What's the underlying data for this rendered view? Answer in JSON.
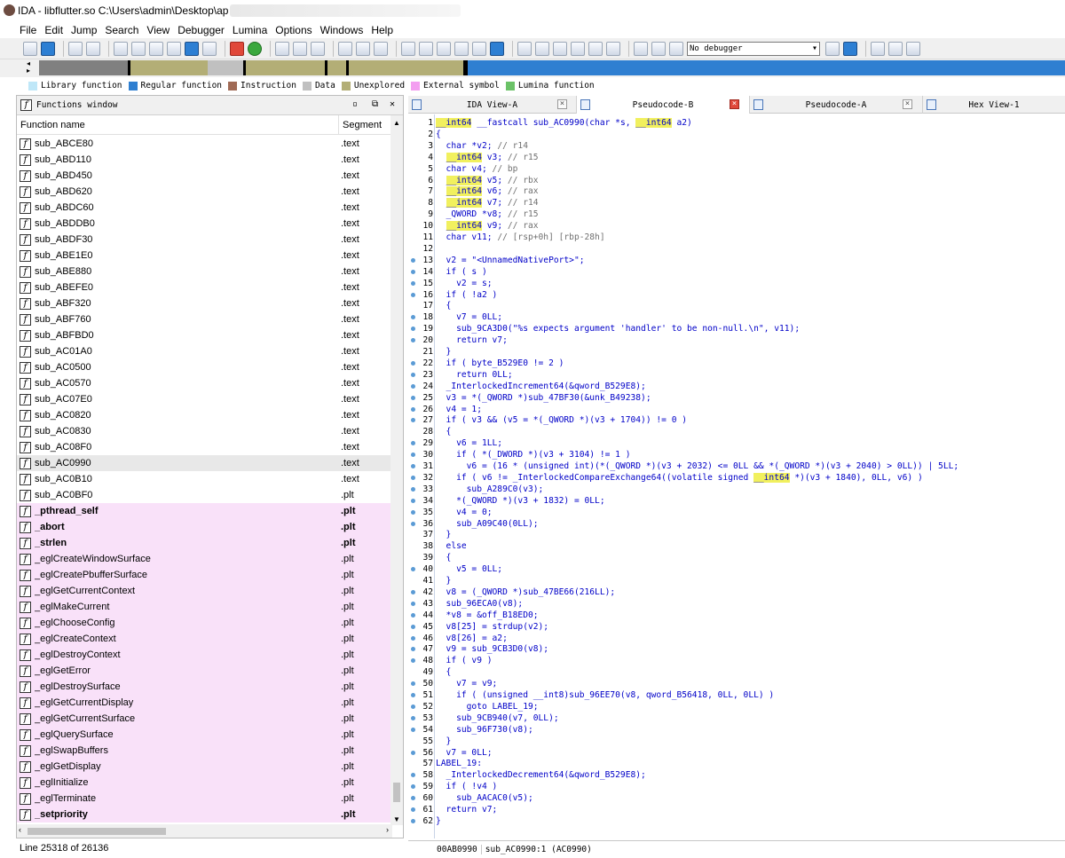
{
  "window": {
    "title": "IDA - libflutter.so C:\\Users\\admin\\Desktop\\ap"
  },
  "menu": [
    "File",
    "Edit",
    "Jump",
    "Search",
    "View",
    "Debugger",
    "Lumina",
    "Options",
    "Windows",
    "Help"
  ],
  "toolbar": {
    "debugger_select": "No debugger"
  },
  "legend": [
    {
      "label": "Library function",
      "color": "#bfe7f8"
    },
    {
      "label": "Regular function",
      "color": "#2f7fd1"
    },
    {
      "label": "Instruction",
      "color": "#a06a55"
    },
    {
      "label": "Data",
      "color": "#c0c0c0"
    },
    {
      "label": "Unexplored",
      "color": "#b3ae76"
    },
    {
      "label": "External symbol",
      "color": "#f39ef0"
    },
    {
      "label": "Lumina function",
      "color": "#6bc267"
    }
  ],
  "functions_window": {
    "title": "Functions window",
    "col_name": "Function name",
    "col_segment": "Segment",
    "rows": [
      {
        "name": "sub_ABCE80",
        "seg": ".text",
        "style": ""
      },
      {
        "name": "sub_ABD110",
        "seg": ".text",
        "style": ""
      },
      {
        "name": "sub_ABD450",
        "seg": ".text",
        "style": ""
      },
      {
        "name": "sub_ABD620",
        "seg": ".text",
        "style": ""
      },
      {
        "name": "sub_ABDC60",
        "seg": ".text",
        "style": ""
      },
      {
        "name": "sub_ABDDB0",
        "seg": ".text",
        "style": ""
      },
      {
        "name": "sub_ABDF30",
        "seg": ".text",
        "style": ""
      },
      {
        "name": "sub_ABE1E0",
        "seg": ".text",
        "style": ""
      },
      {
        "name": "sub_ABE880",
        "seg": ".text",
        "style": ""
      },
      {
        "name": "sub_ABEFE0",
        "seg": ".text",
        "style": ""
      },
      {
        "name": "sub_ABF320",
        "seg": ".text",
        "style": ""
      },
      {
        "name": "sub_ABF760",
        "seg": ".text",
        "style": ""
      },
      {
        "name": "sub_ABFBD0",
        "seg": ".text",
        "style": ""
      },
      {
        "name": "sub_AC01A0",
        "seg": ".text",
        "style": ""
      },
      {
        "name": "sub_AC0500",
        "seg": ".text",
        "style": ""
      },
      {
        "name": "sub_AC0570",
        "seg": ".text",
        "style": ""
      },
      {
        "name": "sub_AC07E0",
        "seg": ".text",
        "style": ""
      },
      {
        "name": "sub_AC0820",
        "seg": ".text",
        "style": ""
      },
      {
        "name": "sub_AC0830",
        "seg": ".text",
        "style": ""
      },
      {
        "name": "sub_AC08F0",
        "seg": ".text",
        "style": ""
      },
      {
        "name": "sub_AC0990",
        "seg": ".text",
        "style": "sel"
      },
      {
        "name": "sub_AC0B10",
        "seg": ".text",
        "style": ""
      },
      {
        "name": "sub_AC0BF0",
        "seg": ".plt",
        "style": ""
      },
      {
        "name": "_pthread_self",
        "seg": ".plt",
        "style": "ext bold"
      },
      {
        "name": "_abort",
        "seg": ".plt",
        "style": "ext bold"
      },
      {
        "name": "_strlen",
        "seg": ".plt",
        "style": "ext bold"
      },
      {
        "name": "_eglCreateWindowSurface",
        "seg": ".plt",
        "style": "ext"
      },
      {
        "name": "_eglCreatePbufferSurface",
        "seg": ".plt",
        "style": "ext"
      },
      {
        "name": "_eglGetCurrentContext",
        "seg": ".plt",
        "style": "ext"
      },
      {
        "name": "_eglMakeCurrent",
        "seg": ".plt",
        "style": "ext"
      },
      {
        "name": "_eglChooseConfig",
        "seg": ".plt",
        "style": "ext"
      },
      {
        "name": "_eglCreateContext",
        "seg": ".plt",
        "style": "ext"
      },
      {
        "name": "_eglDestroyContext",
        "seg": ".plt",
        "style": "ext"
      },
      {
        "name": "_eglGetError",
        "seg": ".plt",
        "style": "ext"
      },
      {
        "name": "_eglDestroySurface",
        "seg": ".plt",
        "style": "ext"
      },
      {
        "name": "_eglGetCurrentDisplay",
        "seg": ".plt",
        "style": "ext"
      },
      {
        "name": "_eglGetCurrentSurface",
        "seg": ".plt",
        "style": "ext"
      },
      {
        "name": "_eglQuerySurface",
        "seg": ".plt",
        "style": "ext"
      },
      {
        "name": "_eglSwapBuffers",
        "seg": ".plt",
        "style": "ext"
      },
      {
        "name": "_eglGetDisplay",
        "seg": ".plt",
        "style": "ext"
      },
      {
        "name": "_eglInitialize",
        "seg": ".plt",
        "style": "ext"
      },
      {
        "name": "_eglTerminate",
        "seg": ".plt",
        "style": "ext"
      },
      {
        "name": "_setpriority",
        "seg": ".plt",
        "style": "ext bold"
      }
    ],
    "status": "Line 25318 of 26136"
  },
  "tabs": [
    {
      "label": "IDA View-A",
      "active": false
    },
    {
      "label": "Pseudocode-B",
      "active": true
    },
    {
      "label": "Pseudocode-A",
      "active": false
    },
    {
      "label": "Hex View-1",
      "active": false
    }
  ],
  "code": {
    "lines": [
      {
        "n": "1",
        "dot": false,
        "html": "<span class='hl'>__int64</span> __fastcall sub_AC0990(char *s, <span class='hl'>__int64</span> a2)"
      },
      {
        "n": "2",
        "dot": false,
        "html": "{"
      },
      {
        "n": "3",
        "dot": false,
        "html": "  char *v2; <span class='gr'>// r14</span>"
      },
      {
        "n": "4",
        "dot": false,
        "html": "  <span class='hl'>__int64</span> v3; <span class='gr'>// r15</span>"
      },
      {
        "n": "5",
        "dot": false,
        "html": "  char v4; <span class='gr'>// bp</span>"
      },
      {
        "n": "6",
        "dot": false,
        "html": "  <span class='hl'>__int64</span> v5; <span class='gr'>// rbx</span>"
      },
      {
        "n": "7",
        "dot": false,
        "html": "  <span class='hl'>__int64</span> v6; <span class='gr'>// rax</span>"
      },
      {
        "n": "8",
        "dot": false,
        "html": "  <span class='hl'>__int64</span> v7; <span class='gr'>// r14</span>"
      },
      {
        "n": "9",
        "dot": false,
        "html": "  _QWORD *v8; <span class='gr'>// r15</span>"
      },
      {
        "n": "10",
        "dot": false,
        "html": "  <span class='hl'>__int64</span> v9; <span class='gr'>// rax</span>"
      },
      {
        "n": "11",
        "dot": false,
        "html": "  char v11; <span class='gr'>// [rsp+0h] [rbp-28h]</span>"
      },
      {
        "n": "12",
        "dot": false,
        "html": ""
      },
      {
        "n": "13",
        "dot": true,
        "html": "  v2 = \"&lt;UnnamedNativePort&gt;\";"
      },
      {
        "n": "14",
        "dot": true,
        "html": "  if ( s )"
      },
      {
        "n": "15",
        "dot": true,
        "html": "    v2 = s;"
      },
      {
        "n": "16",
        "dot": true,
        "html": "  if ( !a2 )"
      },
      {
        "n": "17",
        "dot": false,
        "html": "  {"
      },
      {
        "n": "18",
        "dot": true,
        "html": "    v7 = 0LL;"
      },
      {
        "n": "19",
        "dot": true,
        "html": "    sub_9CA3D0(\"%s expects argument 'handler' to be non-null.\\n\", v11);"
      },
      {
        "n": "20",
        "dot": true,
        "html": "    return v7;"
      },
      {
        "n": "21",
        "dot": false,
        "html": "  }"
      },
      {
        "n": "22",
        "dot": true,
        "html": "  if ( byte_B529E0 != 2 )"
      },
      {
        "n": "23",
        "dot": true,
        "html": "    return 0LL;"
      },
      {
        "n": "24",
        "dot": true,
        "html": "  _InterlockedIncrement64(&amp;qword_B529E8);"
      },
      {
        "n": "25",
        "dot": true,
        "html": "  v3 = *(_QWORD *)sub_47BF30(&amp;unk_B49238);"
      },
      {
        "n": "26",
        "dot": true,
        "html": "  v4 = 1;"
      },
      {
        "n": "27",
        "dot": true,
        "html": "  if ( v3 &amp;&amp; (v5 = *(_QWORD *)(v3 + 1704)) != 0 )"
      },
      {
        "n": "28",
        "dot": false,
        "html": "  {"
      },
      {
        "n": "29",
        "dot": true,
        "html": "    v6 = 1LL;"
      },
      {
        "n": "30",
        "dot": true,
        "html": "    if ( *(_DWORD *)(v3 + 3104) != 1 )"
      },
      {
        "n": "31",
        "dot": true,
        "html": "      v6 = (16 * (unsigned int)(*(_QWORD *)(v3 + 2032) &lt;= 0LL &amp;&amp; *(_QWORD *)(v3 + 2040) &gt; 0LL)) | 5LL;"
      },
      {
        "n": "32",
        "dot": true,
        "html": "    if ( v6 != _InterlockedCompareExchange64((volatile signed <span class='hl'>__int64</span> *)(v3 + 1840), 0LL, v6) )"
      },
      {
        "n": "33",
        "dot": true,
        "html": "      sub_A289C0(v3);"
      },
      {
        "n": "34",
        "dot": true,
        "html": "    *(_QWORD *)(v3 + 1832) = 0LL;"
      },
      {
        "n": "35",
        "dot": true,
        "html": "    v4 = 0;"
      },
      {
        "n": "36",
        "dot": true,
        "html": "    sub_A09C40(0LL);"
      },
      {
        "n": "37",
        "dot": false,
        "html": "  }"
      },
      {
        "n": "38",
        "dot": false,
        "html": "  else"
      },
      {
        "n": "39",
        "dot": false,
        "html": "  {"
      },
      {
        "n": "40",
        "dot": true,
        "html": "    v5 = 0LL;"
      },
      {
        "n": "41",
        "dot": false,
        "html": "  }"
      },
      {
        "n": "42",
        "dot": true,
        "html": "  v8 = (_QWORD *)sub_47BE66(216LL);"
      },
      {
        "n": "43",
        "dot": true,
        "html": "  sub_96ECA0(v8);"
      },
      {
        "n": "44",
        "dot": true,
        "html": "  *v8 = &amp;off_B18ED0;"
      },
      {
        "n": "45",
        "dot": true,
        "html": "  v8[25] = strdup(v2);"
      },
      {
        "n": "46",
        "dot": true,
        "html": "  v8[26] = a2;"
      },
      {
        "n": "47",
        "dot": true,
        "html": "  v9 = sub_9CB3D0(v8);"
      },
      {
        "n": "48",
        "dot": true,
        "html": "  if ( v9 )"
      },
      {
        "n": "49",
        "dot": false,
        "html": "  {"
      },
      {
        "n": "50",
        "dot": true,
        "html": "    v7 = v9;"
      },
      {
        "n": "51",
        "dot": true,
        "html": "    if ( (unsigned __int8)sub_96EE70(v8, qword_B56418, 0LL, 0LL) )"
      },
      {
        "n": "52",
        "dot": true,
        "html": "      goto LABEL_19;"
      },
      {
        "n": "53",
        "dot": true,
        "html": "    sub_9CB940(v7, 0LL);"
      },
      {
        "n": "54",
        "dot": true,
        "html": "    sub_96F730(v8);"
      },
      {
        "n": "55",
        "dot": false,
        "html": "  }"
      },
      {
        "n": "56",
        "dot": true,
        "html": "  v7 = 0LL;"
      },
      {
        "n": "57",
        "dot": false,
        "html": "LABEL_19:"
      },
      {
        "n": "58",
        "dot": true,
        "html": "  _InterlockedDecrement64(&amp;qword_B529E8);"
      },
      {
        "n": "59",
        "dot": true,
        "html": "  if ( !v4 )"
      },
      {
        "n": "60",
        "dot": true,
        "html": "    sub_AACAC0(v5);"
      },
      {
        "n": "61",
        "dot": true,
        "html": "  return v7;"
      },
      {
        "n": "62",
        "dot": true,
        "html": "}"
      }
    ],
    "status_addr": "00AB0990",
    "status_func": "sub_AC0990:1 (AC0990)"
  }
}
